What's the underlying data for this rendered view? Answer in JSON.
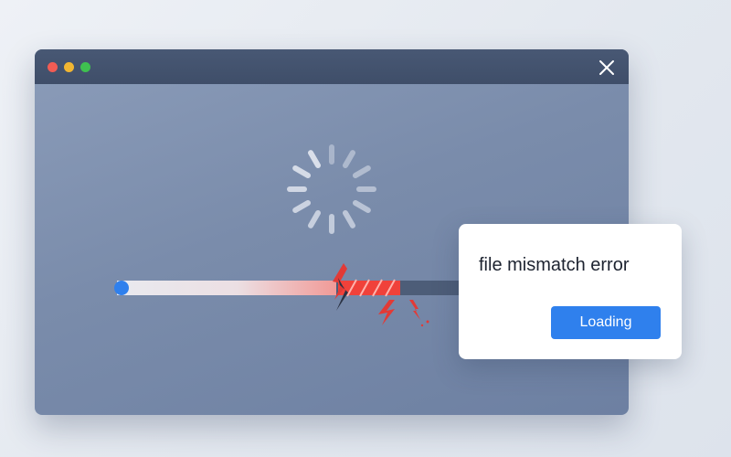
{
  "window": {
    "traffic_lights": [
      "close",
      "minimize",
      "maximize"
    ],
    "close_icon": "close-icon"
  },
  "loader": {
    "icon": "spinner-icon",
    "progress_fraction": 0.55,
    "progress_state": "broken"
  },
  "dialog": {
    "message": "file mismatch error",
    "button_label": "Loading"
  },
  "colors": {
    "window_background": "#7a8cab",
    "titlebar": "#435270",
    "progress_fill": "#e8e9ee",
    "progress_error": "#f0413a",
    "progress_track": "#4d5d78",
    "button_accent": "#2f80ed",
    "traffic_red": "#f25c54",
    "traffic_yellow": "#f2b632",
    "traffic_green": "#3fc150"
  }
}
